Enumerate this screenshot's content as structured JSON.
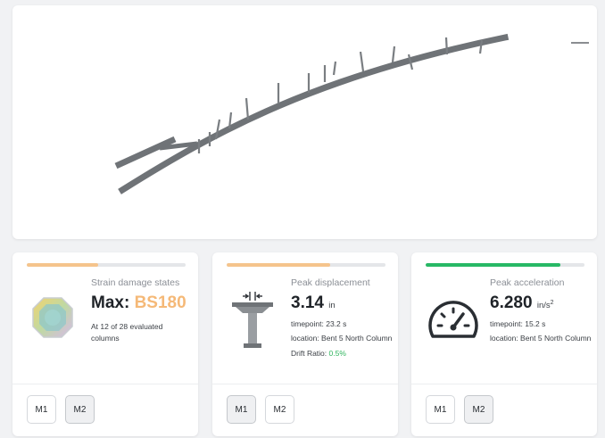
{
  "cards": [
    {
      "label": "Strain damage states",
      "value_prefix": "Max: ",
      "value_highlight": "BS180",
      "note": "At 12 of 28 evaluated columns",
      "progress": 0.45,
      "progress_color": "#f5c48c",
      "highlight_color": "#f5b978",
      "icon": "octagon-damage-icon",
      "buttons": [
        {
          "label": "M1",
          "active": false
        },
        {
          "label": "M2",
          "active": true
        }
      ]
    },
    {
      "label": "Peak displacement",
      "value": "3.14",
      "unit": "in",
      "timepoint": "timepoint: 23.2 s",
      "location": "location: Bent 5 North Column",
      "drift_label": "Drift Ratio: ",
      "drift_value": "0.5%",
      "drift_color": "#2fb55d",
      "progress": 0.65,
      "progress_color": "#f5c48c",
      "icon": "bridge-column-icon",
      "buttons": [
        {
          "label": "M1",
          "active": true
        },
        {
          "label": "M2",
          "active": false
        }
      ]
    },
    {
      "label": "Peak acceleration",
      "value": "6.280",
      "unit": "in/s",
      "unit_sup": "2",
      "timepoint": "timepoint: 15.2 s",
      "location": "location: Bent 5 North Column",
      "progress": 0.85,
      "progress_color": "#27b865",
      "icon": "speedometer-icon",
      "buttons": [
        {
          "label": "M1",
          "active": false
        },
        {
          "label": "M2",
          "active": true
        }
      ]
    }
  ]
}
